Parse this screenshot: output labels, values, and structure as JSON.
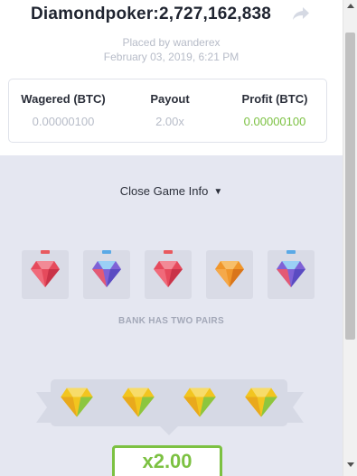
{
  "header": {
    "title": "Diamondpoker:2,727,162,838",
    "placed_by": "Placed by wanderex",
    "date": "February 03, 2019, 6:21 PM"
  },
  "stats": {
    "wagered_label": "Wagered (BTC)",
    "wagered_value": "0.00000100",
    "payout_label": "Payout",
    "payout_value": "2.00x",
    "profit_label": "Profit (BTC)",
    "profit_value": "0.00000100"
  },
  "game_info": {
    "toggle_label": "Close Game Info",
    "bank_label": "BANK HAS TWO PAIRS",
    "multiplier": "x2.00"
  },
  "bank_gems": [
    {
      "name": "red",
      "tab_color": "#e8595e"
    },
    {
      "name": "blue",
      "tab_color": "#5aa9e6"
    },
    {
      "name": "red",
      "tab_color": "#e8595e"
    },
    {
      "name": "orange",
      "tab_color": ""
    },
    {
      "name": "blue",
      "tab_color": "#5aa9e6"
    }
  ],
  "player_gems": [
    "yellow",
    "yellow",
    "yellow",
    "yellow"
  ],
  "colors": {
    "accent_green": "#7cc142",
    "game_bg": "#e5e7f1",
    "muted_text": "#b7bcc8"
  },
  "icons": {
    "share": "share-arrow-icon",
    "chevron": "chevron-down-icon"
  }
}
